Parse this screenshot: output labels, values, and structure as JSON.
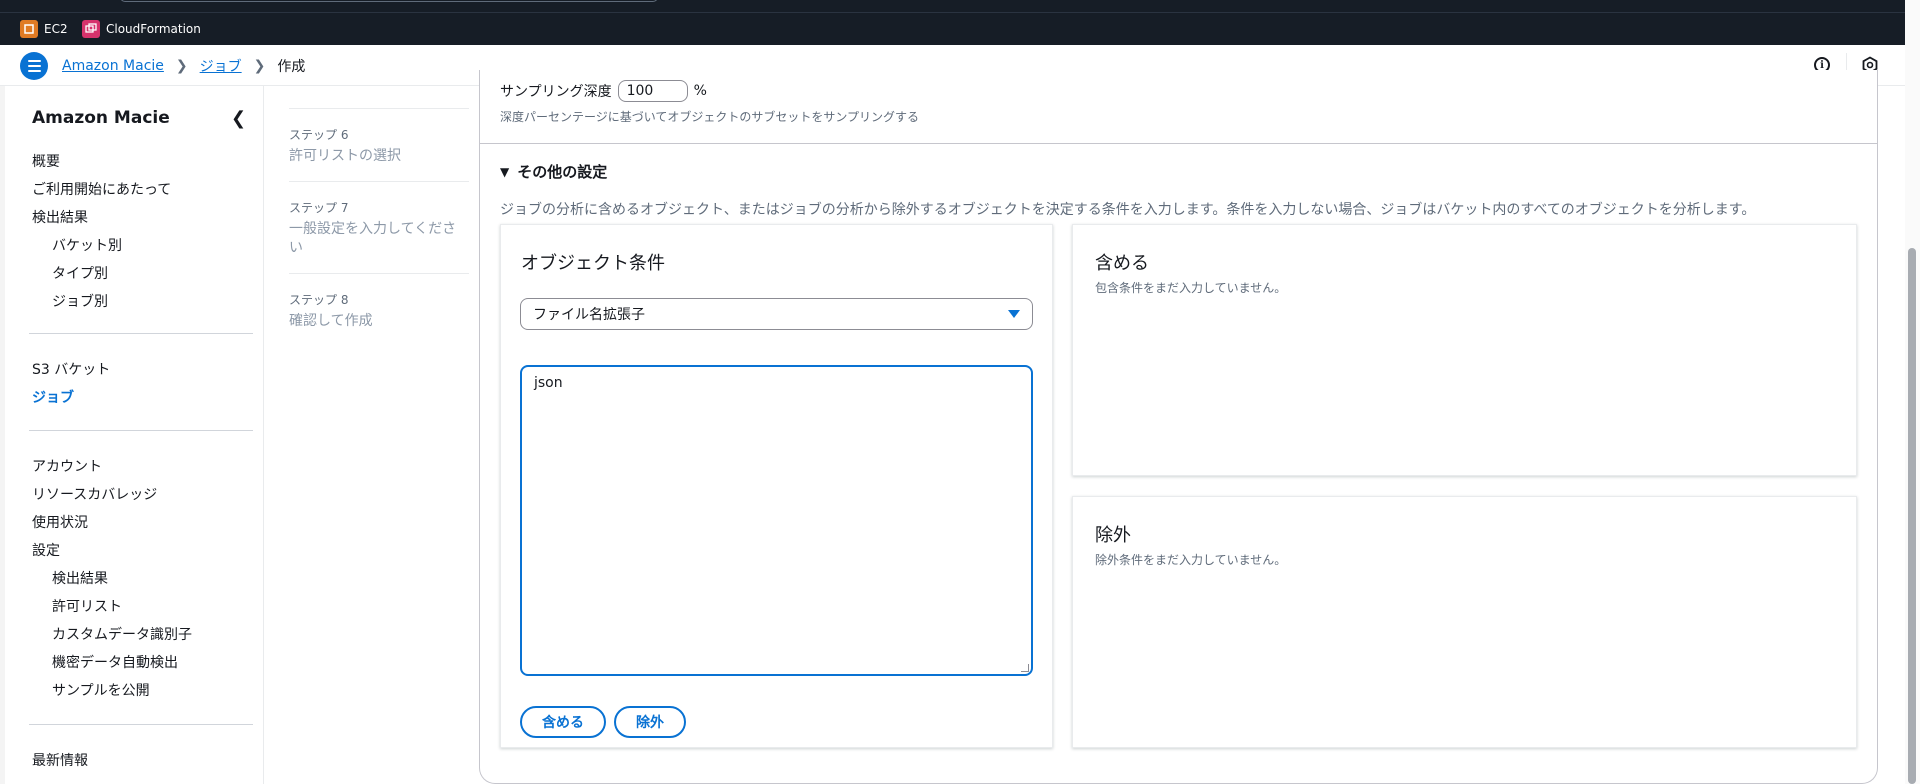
{
  "favorites": [
    {
      "label": "EC2",
      "icon": "ec2-icon",
      "color": "#e07b24"
    },
    {
      "label": "CloudFormation",
      "icon": "cloudformation-icon",
      "color": "#d6336c"
    }
  ],
  "breadcrumb": {
    "items": [
      "Amazon Macie",
      "ジョブ"
    ],
    "current": "作成"
  },
  "sidenav": {
    "title": "Amazon Macie",
    "group1": [
      "概要",
      "ご利用開始にあたって",
      "検出結果"
    ],
    "group1_sub": [
      "バケット別",
      "タイプ別",
      "ジョブ別"
    ],
    "group2": [
      "S3 バケット",
      "ジョブ"
    ],
    "group3": [
      "アカウント",
      "リソースカバレッジ",
      "使用状況",
      "設定"
    ],
    "group3_sub": [
      "検出結果",
      "許可リスト",
      "カスタムデータ識別子",
      "機密データ自動検出",
      "サンプルを公開"
    ],
    "group4": [
      "最新情報"
    ]
  },
  "steps": [
    {
      "label": "ステップ 6",
      "name": "許可リストの選択"
    },
    {
      "label": "ステップ 7",
      "name": "一般設定を入力してください"
    },
    {
      "label": "ステップ 8",
      "name": "確認して作成"
    }
  ],
  "sampling": {
    "label": "サンプリング深度",
    "value": "100",
    "unit": "%",
    "description": "深度パーセンテージに基づいてオブジェクトのサブセットをサンプリングする"
  },
  "other_settings": {
    "title": "その他の設定",
    "description": "ジョブの分析に含めるオブジェクト、またはジョブの分析から除外するオブジェクトを決定する条件を入力します。条件を入力しない場合、ジョブはバケット内のすべてのオブジェクトを分析します。"
  },
  "object_condition": {
    "title": "オブジェクト条件",
    "select_value": "ファイル名拡張子",
    "textarea_value": "json",
    "include_button": "含める",
    "exclude_button": "除外"
  },
  "include_panel": {
    "title": "含める",
    "empty": "包含条件をまだ入力していません。"
  },
  "exclude_panel": {
    "title": "除外",
    "empty": "除外条件をまだ入力していません。"
  },
  "colors": {
    "accent": "#0972d3",
    "topbar": "#161d26"
  }
}
